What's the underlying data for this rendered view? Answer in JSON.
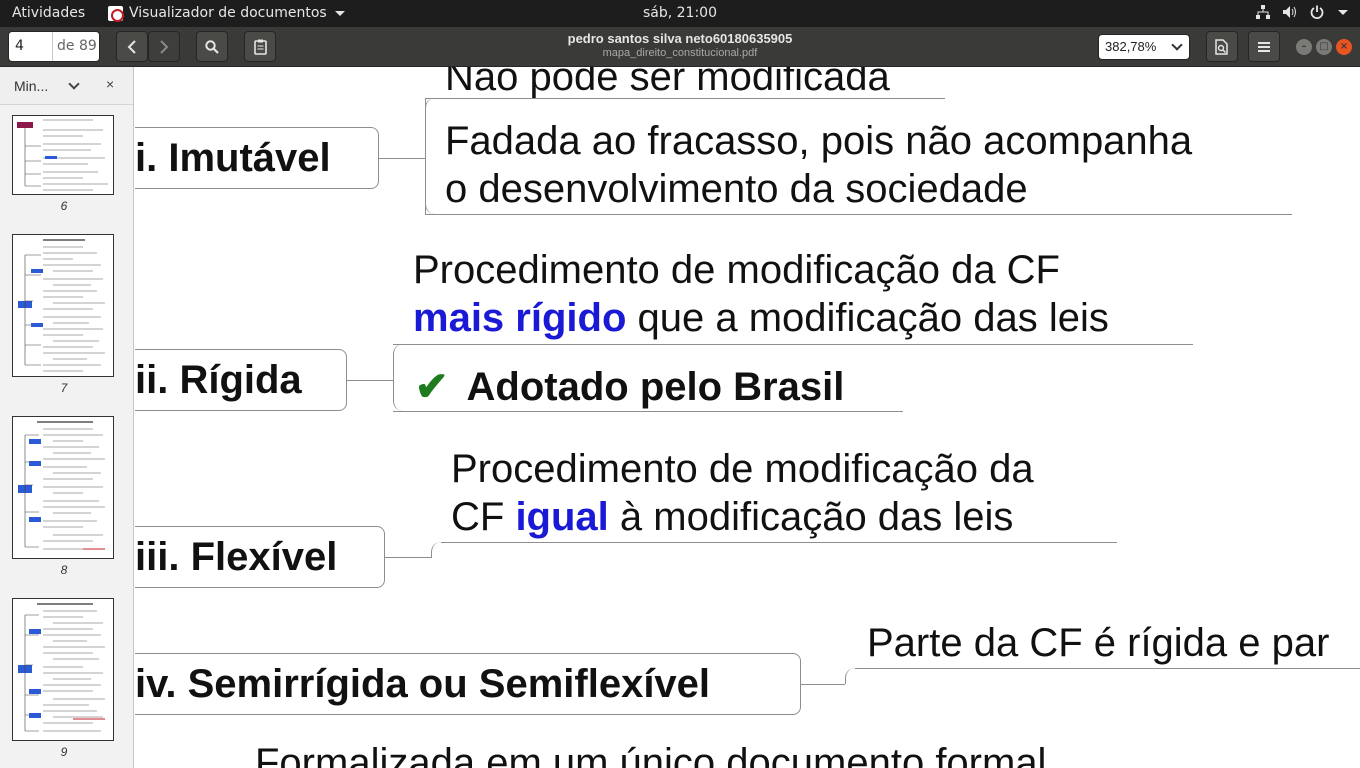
{
  "topbar": {
    "activities": "Atividades",
    "app_name": "Visualizador de documentos",
    "clock": "sáb, 21:00"
  },
  "header": {
    "page_current": "4",
    "page_of": "de 89",
    "doc_title": "pedro santos silva neto60180635905",
    "doc_filename": "mapa_direito_constitucional.pdf",
    "zoom": "382,78%"
  },
  "sidebar": {
    "mode_label": "Min...",
    "thumbnails": [
      {
        "page": "6"
      },
      {
        "page": "7"
      },
      {
        "page": "8"
      },
      {
        "page": "9"
      }
    ]
  },
  "document": {
    "nodes": [
      {
        "label": "i. Imutável"
      },
      {
        "label": "ii. Rígida"
      },
      {
        "label": "iii. Flexível"
      },
      {
        "label": "iv. Semirrígida ou Semiflexível"
      }
    ],
    "imutavel_leaf_1": "Não pode ser modificada",
    "imutavel_leaf_2_line1": "Fadada ao fracasso, pois não acompanha",
    "imutavel_leaf_2_line2": "o desenvolvimento da sociedade",
    "rigida_leaf_line1": "Procedimento de modificação da CF",
    "rigida_leaf_bold": "mais rígido",
    "rigida_leaf_rest": " que a modificação das leis",
    "rigida_check": "✔",
    "rigida_adotado": "Adotado pelo Brasil",
    "flexivel_leaf_line1": "Procedimento de modificação da",
    "flexivel_leaf_prefix": "CF ",
    "flexivel_leaf_bold": "igual",
    "flexivel_leaf_rest": " à modificação das leis",
    "semi_leaf": "Parte da CF é rígida e par",
    "bottom_leaf": "Formalizada em um único documento formal"
  }
}
